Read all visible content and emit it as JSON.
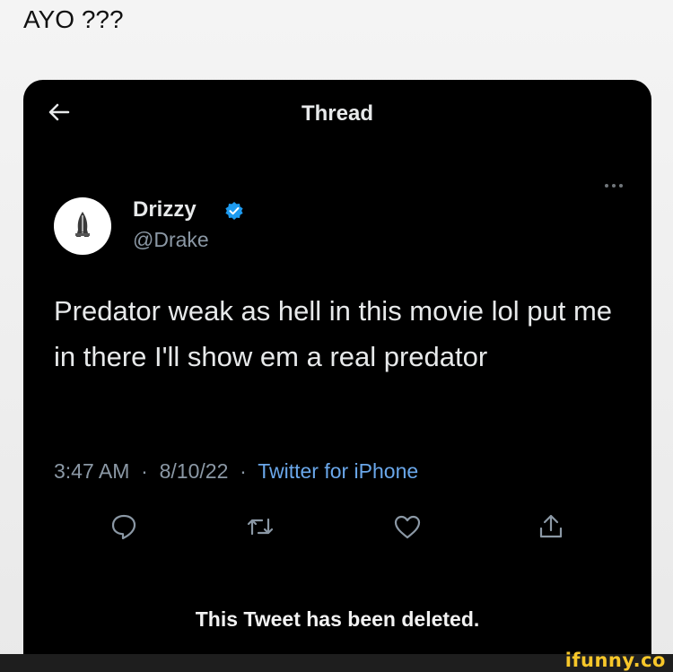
{
  "caption": "AYO ???",
  "header": {
    "title": "Thread"
  },
  "user": {
    "name": "Drizzy",
    "handle": "@Drake",
    "avatar_icon": "praying-hands-icon",
    "verified_color": "#1d9bf0"
  },
  "tweet": {
    "text": "Predator weak as hell in this movie lol put me in there I'll show em a real predator",
    "time": "3:47 AM",
    "date": "8/10/22",
    "source": "Twitter for iPhone"
  },
  "actions": [
    "reply-icon",
    "retweet-icon",
    "like-icon",
    "share-icon"
  ],
  "notice": "This Tweet has been deleted.",
  "watermark": "ifunny.co",
  "colors": {
    "background": "#000000",
    "text": "#e7e9ea",
    "muted": "#8b98a5",
    "link": "#6aa7ea",
    "watermark": "#f7c72a"
  }
}
